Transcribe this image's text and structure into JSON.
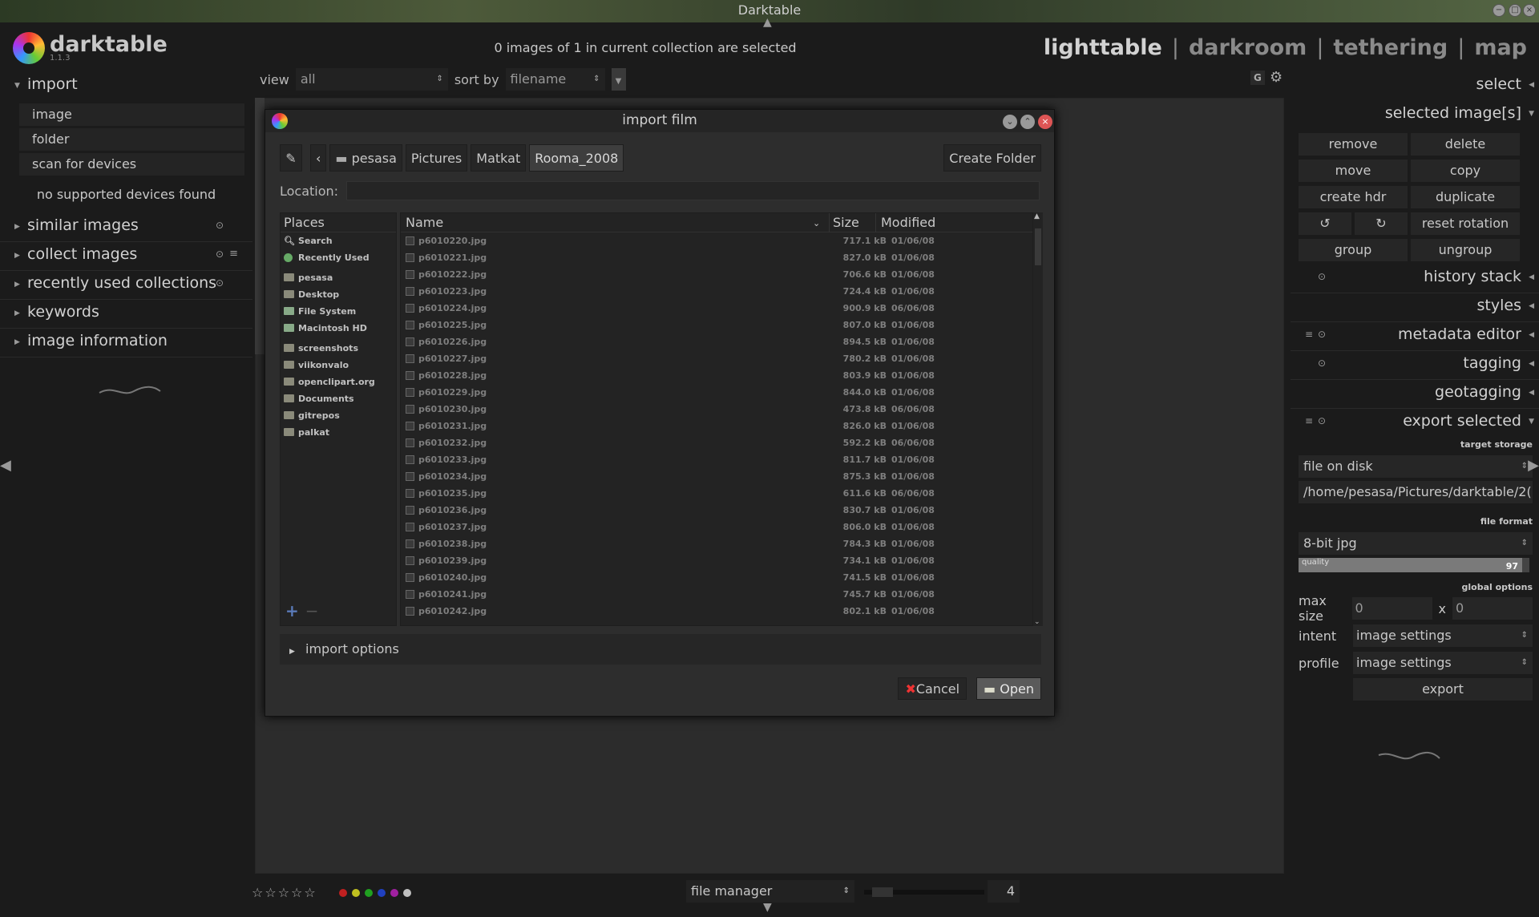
{
  "window": {
    "title": "Darktable"
  },
  "app": {
    "name": "darktable",
    "version": "1.1.3"
  },
  "header": {
    "selection_status": "0 images of 1 in current collection are selected"
  },
  "views": {
    "items": [
      "lighttable",
      "darkroom",
      "tethering",
      "map"
    ],
    "separator": "|",
    "active": "lighttable"
  },
  "toolbar": {
    "view_label": "view",
    "view_value": "all",
    "sort_label": "sort by",
    "sort_value": "filename",
    "g_label": "G"
  },
  "left_panel": {
    "import": {
      "title": "import",
      "buttons": [
        "image",
        "folder",
        "scan for devices"
      ],
      "status": "no supported devices found"
    },
    "sections": [
      {
        "label": "similar images",
        "icons": [
          "circle-icon"
        ]
      },
      {
        "label": "collect images",
        "icons": [
          "circle-icon",
          "list-icon"
        ]
      },
      {
        "label": "recently used collections",
        "icons": [
          "circle-icon"
        ]
      },
      {
        "label": "keywords",
        "icons": []
      },
      {
        "label": "image information",
        "icons": []
      }
    ]
  },
  "dialog": {
    "title": "import film",
    "path": [
      "pesasa",
      "Pictures",
      "Matkat",
      "Rooma_2008"
    ],
    "create_folder": "Create Folder",
    "location_label": "Location:",
    "location_value": "",
    "places_header": "Places",
    "places": [
      "Search",
      "Recently Used",
      "pesasa",
      "Desktop",
      "File System",
      "Macintosh HD",
      "screenshots",
      "viikonvalo",
      "openclipart.org",
      "Documents",
      "gitrepos",
      "palkat"
    ],
    "columns": {
      "name": "Name",
      "size": "Size",
      "modified": "Modified"
    },
    "files": [
      {
        "name": "p6010220.jpg",
        "size": "717.1 kB",
        "modified": "01/06/08"
      },
      {
        "name": "p6010221.jpg",
        "size": "827.0 kB",
        "modified": "01/06/08"
      },
      {
        "name": "p6010222.jpg",
        "size": "706.6 kB",
        "modified": "01/06/08"
      },
      {
        "name": "p6010223.jpg",
        "size": "724.4 kB",
        "modified": "01/06/08"
      },
      {
        "name": "p6010224.jpg",
        "size": "900.9 kB",
        "modified": "06/06/08"
      },
      {
        "name": "p6010225.jpg",
        "size": "807.0 kB",
        "modified": "01/06/08"
      },
      {
        "name": "p6010226.jpg",
        "size": "894.5 kB",
        "modified": "01/06/08"
      },
      {
        "name": "p6010227.jpg",
        "size": "780.2 kB",
        "modified": "01/06/08"
      },
      {
        "name": "p6010228.jpg",
        "size": "803.9 kB",
        "modified": "01/06/08"
      },
      {
        "name": "p6010229.jpg",
        "size": "844.0 kB",
        "modified": "01/06/08"
      },
      {
        "name": "p6010230.jpg",
        "size": "473.8 kB",
        "modified": "06/06/08"
      },
      {
        "name": "p6010231.jpg",
        "size": "826.0 kB",
        "modified": "01/06/08"
      },
      {
        "name": "p6010232.jpg",
        "size": "592.2 kB",
        "modified": "06/06/08"
      },
      {
        "name": "p6010233.jpg",
        "size": "811.7 kB",
        "modified": "01/06/08"
      },
      {
        "name": "p6010234.jpg",
        "size": "875.3 kB",
        "modified": "01/06/08"
      },
      {
        "name": "p6010235.jpg",
        "size": "611.6 kB",
        "modified": "06/06/08"
      },
      {
        "name": "p6010236.jpg",
        "size": "830.7 kB",
        "modified": "01/06/08"
      },
      {
        "name": "p6010237.jpg",
        "size": "806.0 kB",
        "modified": "01/06/08"
      },
      {
        "name": "p6010238.jpg",
        "size": "784.3 kB",
        "modified": "01/06/08"
      },
      {
        "name": "p6010239.jpg",
        "size": "734.1 kB",
        "modified": "01/06/08"
      },
      {
        "name": "p6010240.jpg",
        "size": "741.5 kB",
        "modified": "01/06/08"
      },
      {
        "name": "p6010241.jpg",
        "size": "745.7 kB",
        "modified": "01/06/08"
      },
      {
        "name": "p6010242.jpg",
        "size": "802.1 kB",
        "modified": "01/06/08"
      }
    ],
    "import_options": "import options",
    "cancel": "Cancel",
    "open": "Open"
  },
  "right_panel": {
    "select": "select",
    "selected_images": {
      "title": "selected image[s]",
      "buttons": [
        "remove",
        "delete",
        "move",
        "copy",
        "create hdr",
        "duplicate"
      ],
      "reset_rotation": "reset rotation",
      "group": "group",
      "ungroup": "ungroup"
    },
    "sections": [
      "history stack",
      "styles",
      "metadata editor",
      "tagging",
      "geotagging"
    ],
    "export": {
      "title": "export selected",
      "target_storage_label": "target storage",
      "storage": "file on disk",
      "path": "/home/pesasa/Pictures/darktable/2(",
      "file_format_label": "file format",
      "format": "8-bit jpg",
      "quality_label": "quality",
      "quality": "97",
      "quality_fraction": 0.97,
      "global_options_label": "global options",
      "max_size_label": "max size",
      "max_w": "0",
      "x": "x",
      "max_h": "0",
      "intent_label": "intent",
      "intent": "image settings",
      "profile_label": "profile",
      "profile": "image settings",
      "export_button": "export"
    }
  },
  "bottom": {
    "stars": "☆☆☆☆☆",
    "color_labels": [
      "#c02020",
      "#c0c020",
      "#20a020",
      "#2040c0",
      "#a020a0",
      "#c0c0c0"
    ],
    "layout": "file manager",
    "zoom": "4"
  }
}
